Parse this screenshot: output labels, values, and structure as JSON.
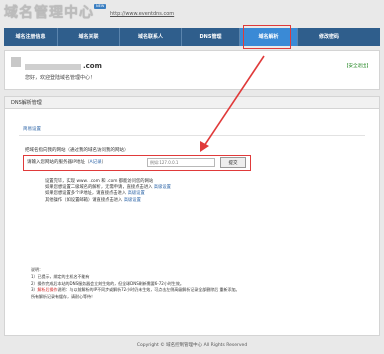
{
  "header": {
    "logo_text": "域名管理中心",
    "logo_badge": "NEW",
    "site_url": "http://www.eventdns.com"
  },
  "nav": {
    "items": [
      {
        "label": "域名注册信息"
      },
      {
        "label": "域名关联"
      },
      {
        "label": "域名联系人"
      },
      {
        "label": "DNS管理"
      },
      {
        "label": "域名解析"
      },
      {
        "label": "修改密码"
      }
    ],
    "active_index": 4
  },
  "user": {
    "domain_suffix": ".com",
    "welcome": "您好，欢迎登陆域名管理中心！",
    "logout": "【安全退出】"
  },
  "dns": {
    "title": "DNS解析管理",
    "subtab": "简易设置",
    "intro": "把域名指向我的网站（通过我的域名访问我的网站）",
    "ip_label": "请输入您网站的服务器IP地址（",
    "ip_label_link": "A记录",
    "ip_label_end": "）",
    "ip_placeholder": "例如:127.0.0.1",
    "submit": "提交",
    "tips": [
      {
        "text": "设置完毕，实现 www.            .com 和             .com 都能访问您的网站",
        "link": ""
      },
      {
        "text": "如果您想设置二级域名的解析，无需申请，直接点击进入 ",
        "link": "高级设置"
      },
      {
        "text": "如果您想设置多个IP地址，请直接点击进入 ",
        "link": "高级设置"
      },
      {
        "text": "其他操作（如设置邮箱）请直接点击进入 ",
        "link": "高级设置"
      }
    ],
    "notes_title": "说明：",
    "notes": [
      {
        "text": "1）已提示，绑定的主机名不能有",
        "warn": ""
      },
      {
        "text": "2）操作完成后本站的DNS服务器会立刻生效的，但全球DNS刷新需要6-72小时生效。",
        "warn": ""
      },
      {
        "text": "3）",
        "warn": "解析后操作",
        "rest": "说明：与以前解析的IP不同步或解析72小时仍未生效，可点击左侧高级解析记录全部删除后 重新添加。"
      },
      {
        "text": "所有解析记录有缓存，请耐心等待！",
        "warn": ""
      }
    ]
  },
  "footer": {
    "copyright": "Copyright © 域名控制管理中心 All Rights Reserved"
  }
}
